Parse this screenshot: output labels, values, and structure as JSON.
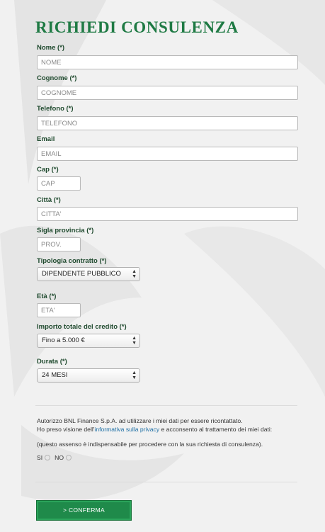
{
  "form": {
    "title": "RICHIEDI CONSULENZA",
    "fields": {
      "nome": {
        "label": "Nome (*)",
        "placeholder": "NOME"
      },
      "cognome": {
        "label": "Cognome (*)",
        "placeholder": "COGNOME"
      },
      "telefono": {
        "label": "Telefono (*)",
        "placeholder": "TELEFONO"
      },
      "email": {
        "label": "Email",
        "placeholder": "EMAIL"
      },
      "cap": {
        "label": "Cap (*)",
        "placeholder": "CAP"
      },
      "citta": {
        "label": "Città (*)",
        "placeholder": "CITTA'"
      },
      "provincia": {
        "label": "Sigla provincia (*)",
        "placeholder": "PROV."
      },
      "tipologia": {
        "label": "Tipologia contratto (*)",
        "value": "DIPENDENTE PUBBLICO"
      },
      "eta": {
        "label": "Età (*)",
        "placeholder": "ETA'"
      },
      "importo": {
        "label": "Importo totale del credito (*)",
        "value": "Fino a 5.000 €"
      },
      "durata": {
        "label": "Durata (*)",
        "value": "24 MESI"
      }
    },
    "consent": {
      "line1": "Autorizzo BNL Finance S.p.A. ad utilizzare i miei dati per essere ricontattato.",
      "line2_prefix": "Ho preso visione dell'",
      "line2_link": "informativa sulla privacy",
      "line2_suffix": " e acconsento al trattamento dei miei dati:",
      "line3": "(questo assenso è indispensabile per procedere con la sua richiesta di consulenza).",
      "yes_label": "SI",
      "no_label": "NO"
    },
    "submit_label": "> CONFERMA"
  }
}
